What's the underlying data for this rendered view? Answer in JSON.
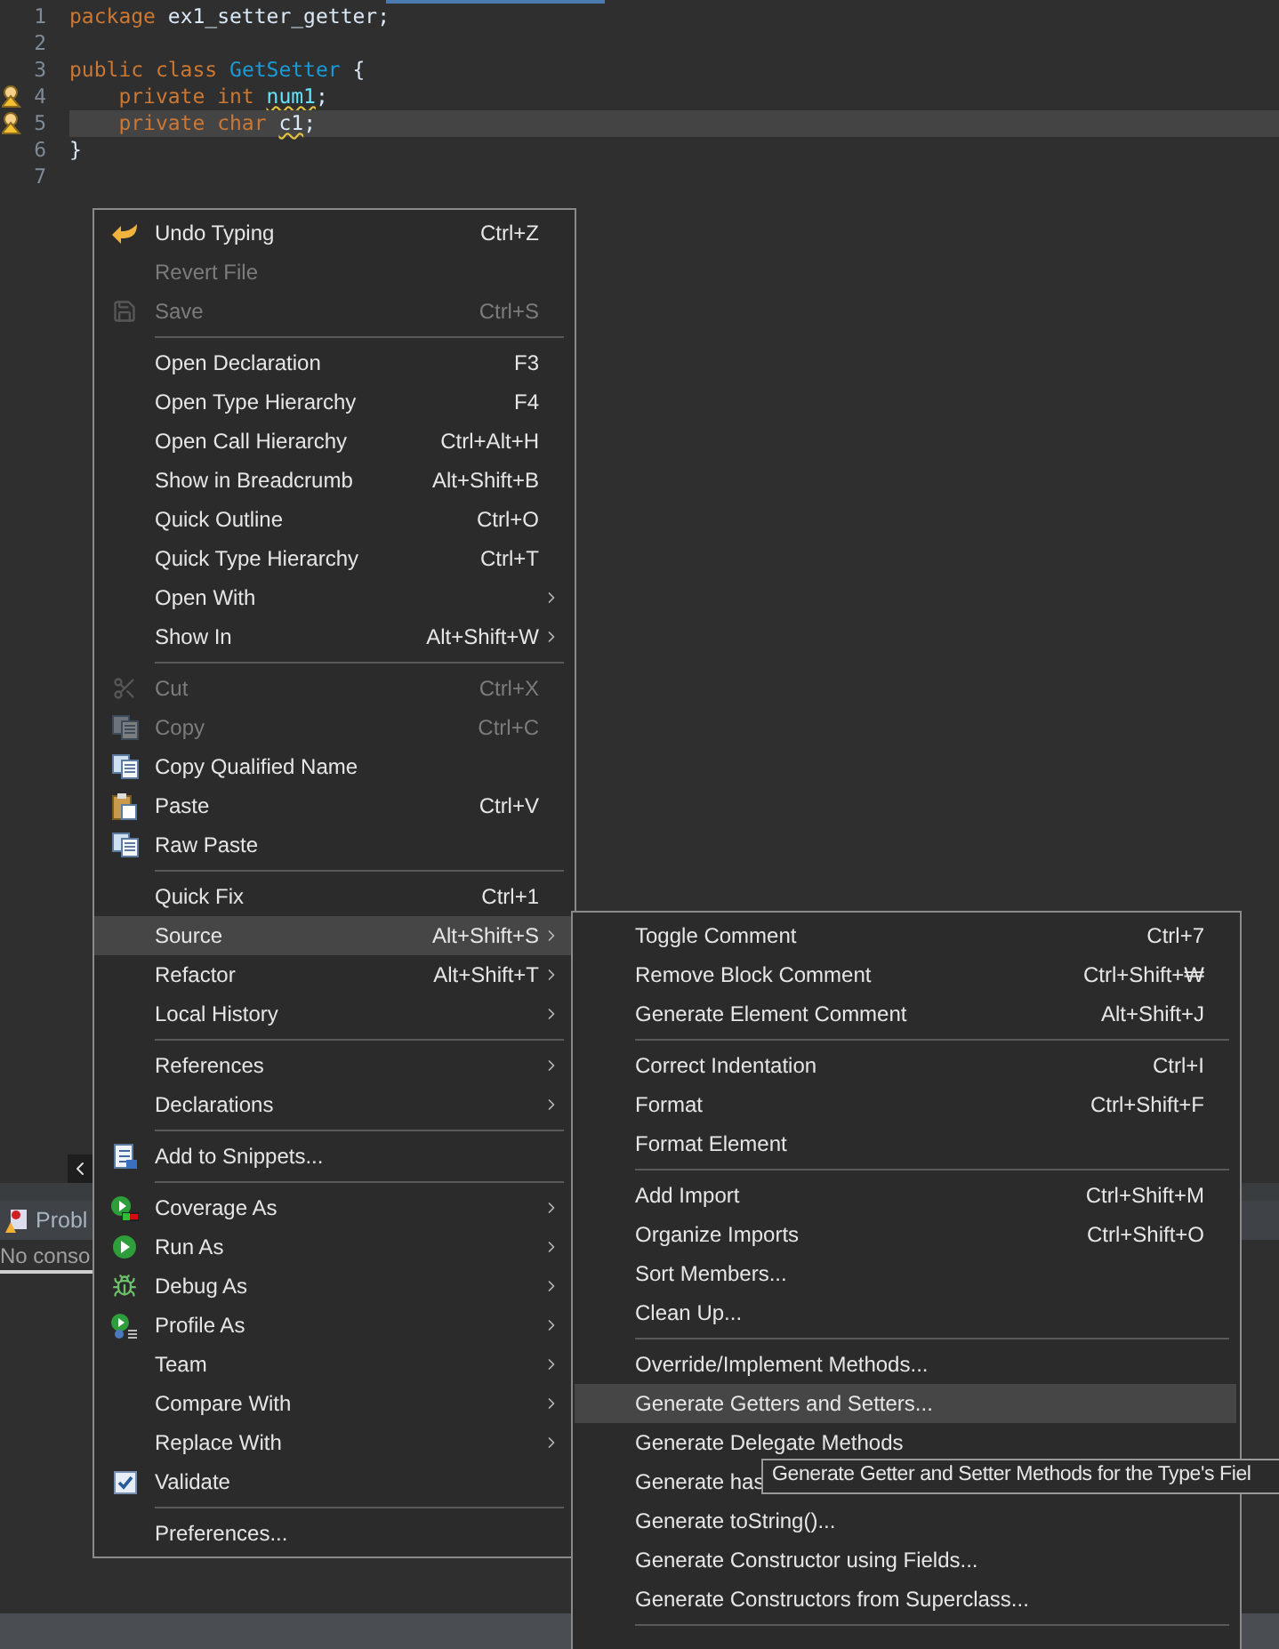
{
  "editor": {
    "lines": [
      {
        "number": "1",
        "warning": false,
        "current": false,
        "tokens": [
          {
            "kind": "keyword",
            "text": "package ",
            "squiggle": false
          },
          {
            "kind": "plain",
            "text": "ex1_setter_getter;",
            "squiggle": false
          }
        ]
      },
      {
        "number": "2",
        "warning": false,
        "current": false
      },
      {
        "number": "3",
        "warning": false,
        "current": false,
        "tokens": [
          {
            "kind": "keyword",
            "text": "public class ",
            "squiggle": false
          },
          {
            "kind": "type",
            "text": "GetSetter",
            "squiggle": false
          },
          {
            "kind": "plain",
            "text": " {",
            "squiggle": false
          }
        ]
      },
      {
        "number": "4",
        "warning": true,
        "current": false,
        "tokens": [
          {
            "kind": "keyword",
            "text": "    private int ",
            "squiggle": false
          },
          {
            "kind": "field",
            "text": "num1",
            "squiggle": true
          },
          {
            "kind": "plain",
            "text": ";",
            "squiggle": false
          }
        ]
      },
      {
        "number": "5",
        "warning": true,
        "current": true,
        "tokens": [
          {
            "kind": "keyword",
            "text": "    private char ",
            "squiggle": false
          },
          {
            "kind": "plain",
            "text": "c1",
            "squiggle": true
          },
          {
            "kind": "plain",
            "text": ";",
            "squiggle": false
          }
        ]
      },
      {
        "number": "6",
        "warning": false,
        "current": false,
        "tokens": [
          {
            "kind": "plain",
            "text": "}",
            "squiggle": false
          }
        ]
      },
      {
        "number": "7",
        "warning": false,
        "current": false
      }
    ]
  },
  "panel": {
    "tab": "Probl",
    "message": "No conso"
  },
  "context_menu": [
    {
      "kind": "item",
      "label": "Undo Typing",
      "shortcut": "Ctrl+Z",
      "disabled": false,
      "submenu": false,
      "selected": false
    },
    {
      "kind": "item",
      "label": "Revert File",
      "disabled": true,
      "submenu": false,
      "selected": false
    },
    {
      "kind": "item",
      "label": "Save",
      "shortcut": "Ctrl+S",
      "disabled": true,
      "submenu": false,
      "selected": false
    },
    {
      "kind": "separator"
    },
    {
      "kind": "item",
      "label": "Open Declaration",
      "shortcut": "F3",
      "disabled": false,
      "submenu": false,
      "selected": false
    },
    {
      "kind": "item",
      "label": "Open Type Hierarchy",
      "shortcut": "F4",
      "disabled": false,
      "submenu": false,
      "selected": false
    },
    {
      "kind": "item",
      "label": "Open Call Hierarchy",
      "shortcut": "Ctrl+Alt+H",
      "disabled": false,
      "submenu": false,
      "selected": false
    },
    {
      "kind": "item",
      "label": "Show in Breadcrumb",
      "shortcut": "Alt+Shift+B",
      "disabled": false,
      "submenu": false,
      "selected": false
    },
    {
      "kind": "item",
      "label": "Quick Outline",
      "shortcut": "Ctrl+O",
      "disabled": false,
      "submenu": false,
      "selected": false
    },
    {
      "kind": "item",
      "label": "Quick Type Hierarchy",
      "shortcut": "Ctrl+T",
      "disabled": false,
      "submenu": false,
      "selected": false
    },
    {
      "kind": "item",
      "label": "Open With",
      "disabled": false,
      "submenu": true,
      "selected": false
    },
    {
      "kind": "item",
      "label": "Show In",
      "shortcut": "Alt+Shift+W",
      "disabled": false,
      "submenu": true,
      "selected": false
    },
    {
      "kind": "separator"
    },
    {
      "kind": "item",
      "label": "Cut",
      "shortcut": "Ctrl+X",
      "disabled": true,
      "submenu": false,
      "selected": false
    },
    {
      "kind": "item",
      "label": "Copy",
      "shortcut": "Ctrl+C",
      "disabled": true,
      "submenu": false,
      "selected": false
    },
    {
      "kind": "item",
      "label": "Copy Qualified Name",
      "disabled": false,
      "submenu": false,
      "selected": false
    },
    {
      "kind": "item",
      "label": "Paste",
      "shortcut": "Ctrl+V",
      "disabled": false,
      "submenu": false,
      "selected": false
    },
    {
      "kind": "item",
      "label": "Raw Paste",
      "disabled": false,
      "submenu": false,
      "selected": false
    },
    {
      "kind": "separator"
    },
    {
      "kind": "item",
      "label": "Quick Fix",
      "shortcut": "Ctrl+1",
      "disabled": false,
      "submenu": false,
      "selected": false
    },
    {
      "kind": "item",
      "label": "Source",
      "shortcut": "Alt+Shift+S",
      "disabled": false,
      "submenu": true,
      "selected": true
    },
    {
      "kind": "item",
      "label": "Refactor",
      "shortcut": "Alt+Shift+T",
      "disabled": false,
      "submenu": true,
      "selected": false
    },
    {
      "kind": "item",
      "label": "Local History",
      "disabled": false,
      "submenu": true,
      "selected": false
    },
    {
      "kind": "separator"
    },
    {
      "kind": "item",
      "label": "References",
      "disabled": false,
      "submenu": true,
      "selected": false
    },
    {
      "kind": "item",
      "label": "Declarations",
      "disabled": false,
      "submenu": true,
      "selected": false
    },
    {
      "kind": "separator"
    },
    {
      "kind": "item",
      "label": "Add to Snippets...",
      "disabled": false,
      "submenu": false,
      "selected": false
    },
    {
      "kind": "separator"
    },
    {
      "kind": "item",
      "label": "Coverage As",
      "disabled": false,
      "submenu": true,
      "selected": false
    },
    {
      "kind": "item",
      "label": "Run As",
      "disabled": false,
      "submenu": true,
      "selected": false
    },
    {
      "kind": "item",
      "label": "Debug As",
      "disabled": false,
      "submenu": true,
      "selected": false
    },
    {
      "kind": "item",
      "label": "Profile As",
      "disabled": false,
      "submenu": true,
      "selected": false
    },
    {
      "kind": "item",
      "label": "Team",
      "disabled": false,
      "submenu": true,
      "selected": false
    },
    {
      "kind": "item",
      "label": "Compare With",
      "disabled": false,
      "submenu": true,
      "selected": false
    },
    {
      "kind": "item",
      "label": "Replace With",
      "disabled": false,
      "submenu": true,
      "selected": false
    },
    {
      "kind": "item",
      "label": "Validate",
      "disabled": false,
      "submenu": false,
      "selected": false
    },
    {
      "kind": "separator"
    },
    {
      "kind": "item",
      "label": "Preferences...",
      "disabled": false,
      "submenu": false,
      "selected": false
    }
  ],
  "source_submenu": [
    {
      "kind": "item",
      "label": "Toggle Comment",
      "shortcut": "Ctrl+7",
      "selected": false
    },
    {
      "kind": "item",
      "label": "Remove Block Comment",
      "shortcut": "Ctrl+Shift+₩",
      "selected": false
    },
    {
      "kind": "item",
      "label": "Generate Element Comment",
      "shortcut": "Alt+Shift+J",
      "selected": false
    },
    {
      "kind": "separator"
    },
    {
      "kind": "item",
      "label": "Correct Indentation",
      "shortcut": "Ctrl+I",
      "selected": false
    },
    {
      "kind": "item",
      "label": "Format",
      "shortcut": "Ctrl+Shift+F",
      "selected": false
    },
    {
      "kind": "item",
      "label": "Format Element",
      "selected": false
    },
    {
      "kind": "separator"
    },
    {
      "kind": "item",
      "label": "Add Import",
      "shortcut": "Ctrl+Shift+M",
      "selected": false
    },
    {
      "kind": "item",
      "label": "Organize Imports",
      "shortcut": "Ctrl+Shift+O",
      "selected": false
    },
    {
      "kind": "item",
      "label": "Sort Members...",
      "selected": false
    },
    {
      "kind": "item",
      "label": "Clean Up...",
      "selected": false
    },
    {
      "kind": "separator"
    },
    {
      "kind": "item",
      "label": "Override/Implement Methods...",
      "selected": false
    },
    {
      "kind": "item",
      "label": "Generate Getters and Setters...",
      "selected": true
    },
    {
      "kind": "item",
      "label": "Generate Delegate Methods",
      "selected": false
    },
    {
      "kind": "item",
      "label": "Generate has",
      "selected": false
    },
    {
      "kind": "item",
      "label": "Generate toString()...",
      "selected": false
    },
    {
      "kind": "item",
      "label": "Generate Constructor using Fields...",
      "selected": false
    },
    {
      "kind": "item",
      "label": "Generate Constructors from Superclass...",
      "selected": false
    },
    {
      "kind": "separator"
    }
  ],
  "tooltip": "Generate Getter and Setter Methods for the Type's Fiel"
}
